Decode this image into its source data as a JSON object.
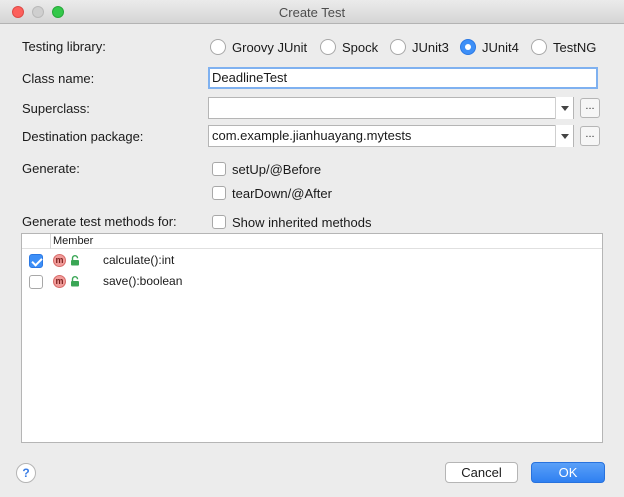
{
  "window": {
    "title": "Create Test"
  },
  "testing_library": {
    "label": "Testing library:",
    "options": [
      "Groovy JUnit",
      "Spock",
      "JUnit3",
      "JUnit4",
      "TestNG"
    ],
    "selected": "JUnit4"
  },
  "class_name": {
    "label": "Class name:",
    "value": "DeadlineTest"
  },
  "superclass": {
    "label": "Superclass:",
    "value": "",
    "browse_label": "..."
  },
  "destination": {
    "label": "Destination package:",
    "value": "com.example.jianhuayang.mytests",
    "browse_label": "..."
  },
  "generate": {
    "label": "Generate:",
    "setup": {
      "label": "setUp/@Before",
      "checked": false
    },
    "teardown": {
      "label": "tearDown/@After",
      "checked": false
    }
  },
  "methods": {
    "label": "Generate test methods for:",
    "show_inherited": {
      "label": "Show inherited methods",
      "checked": false
    },
    "header": "Member",
    "method_icon_letter": "m",
    "rows": [
      {
        "name": "calculate():int",
        "checked": true
      },
      {
        "name": "save():boolean",
        "checked": false
      }
    ]
  },
  "footer": {
    "help_label": "?",
    "cancel_label": "Cancel",
    "ok_label": "OK"
  },
  "colors": {
    "accent": "#3d8ff7",
    "method_icon": "#f19c9a",
    "lock_icon": "#3aa655"
  }
}
